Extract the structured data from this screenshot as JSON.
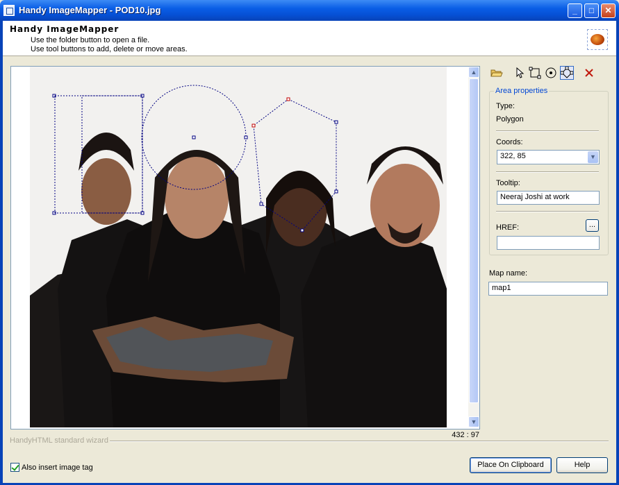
{
  "window": {
    "title": "Handy ImageMapper - POD10.jpg"
  },
  "header": {
    "title": "Handy ImageMapper",
    "line1": "Use the folder button to open a file.",
    "line2": "Use tool buttons to add, delete or move areas."
  },
  "status": {
    "coords": "432 : 97"
  },
  "area_properties": {
    "legend": "Area properties",
    "type_label": "Type:",
    "type_value": "Polygon",
    "coords_label": "Coords:",
    "coords_value": "322, 85",
    "tooltip_label": "Tooltip:",
    "tooltip_value": "Neeraj Joshi at work",
    "href_label": "HREF:",
    "href_value": "",
    "browse_label": "..."
  },
  "map": {
    "label": "Map name:",
    "value": "map1"
  },
  "footer": {
    "wizard": "HandyHTML standard wizard",
    "checkbox_label": "Also insert image tag",
    "checkbox_checked": true,
    "clipboard_button": "Place On Clipboard",
    "help_button": "Help"
  },
  "tools": [
    "open-folder-icon",
    "pointer-icon",
    "rectangle-icon",
    "circle-icon",
    "polygon-icon",
    "delete-icon"
  ],
  "colors": {
    "title_bar": "#0A5EE6",
    "window_bg": "#ECE9D8",
    "accent": "#0046D5",
    "selection": "#000080"
  }
}
